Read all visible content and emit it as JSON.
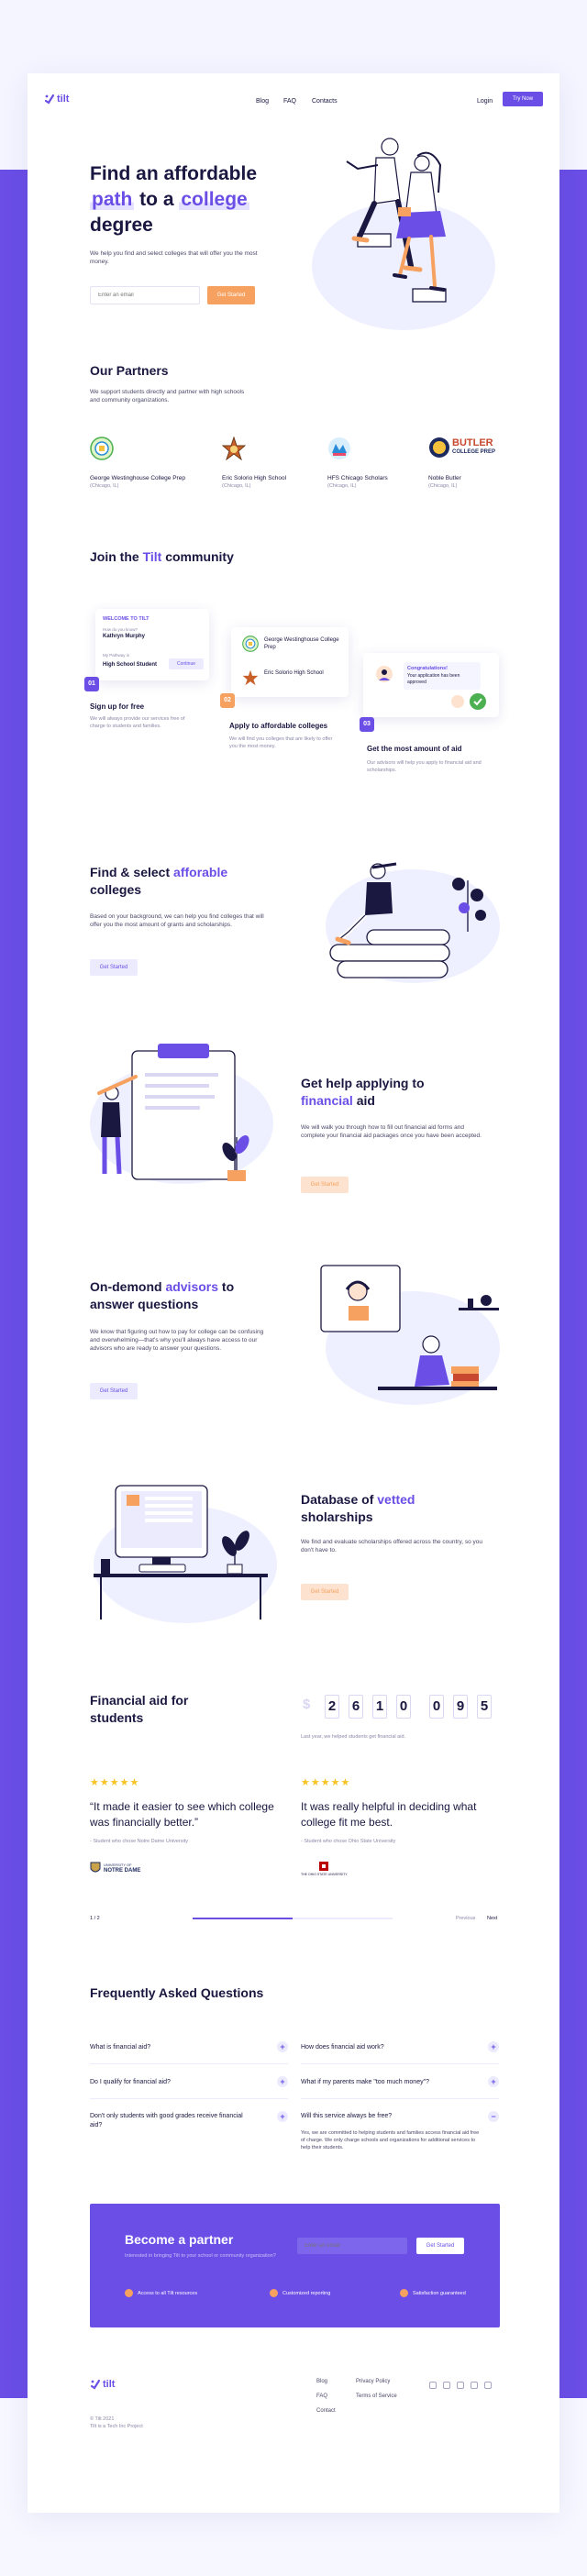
{
  "brand": {
    "logo": "tilt",
    "accent": "#6a4ee6",
    "orange": "#f6a15f"
  },
  "nav": {
    "links": [
      "Blog",
      "FAQ",
      "Contacts"
    ],
    "login": "Login",
    "cta": "Try Now"
  },
  "hero": {
    "title_1": "Find an affordable",
    "title_hl_1": "path",
    "title_2": "to a",
    "title_hl_2": "college",
    "title_3": "degree",
    "subtitle": "We help you find and select colleges that will offer you the most money.",
    "input_placeholder": "Enter an email",
    "button": "Get Started"
  },
  "partners": {
    "title": "Our Partners",
    "subtitle": "We support students directly and partner with high schools and community organizations.",
    "items": [
      {
        "name": "George Westinghouse College Prep",
        "location": "(Chicago, IL)"
      },
      {
        "name": "Eric Solorio High School",
        "location": "(Chicago, IL)"
      },
      {
        "name": "HFS Chicago Scholars",
        "location": "(Chicago, IL)"
      },
      {
        "name": "Noble Butler",
        "location": "(Chicago, IL)"
      }
    ],
    "butler_logo_1": "BUTLER",
    "butler_logo_2": "COLLEGE PREP"
  },
  "community": {
    "title_1": "Join the",
    "title_hl": "Tilt",
    "title_2": "community",
    "signup_card": {
      "heading": "WELCOME TO TILT",
      "field_1_label": "How do you know?",
      "field_1_value": "Kathryn Murphy",
      "field_2_label": "My Pathway is",
      "field_2_value": "High School Student",
      "button": "Continue"
    },
    "steps": [
      {
        "num": "01",
        "title": "Sign up for free",
        "text": "We will always provide our services free of charge to students and families."
      },
      {
        "num": "02",
        "title": "Apply to affordable colleges",
        "text": "We will find you colleges that are likely to offer you the most money."
      },
      {
        "num": "03",
        "title": "Get the most amount of aid",
        "text": "Our advisors will help you apply to financial aid and scholarships."
      }
    ],
    "apply_card": [
      "George Westinghouse College Prep",
      "Eric Solorio High School"
    ],
    "aid_card": {
      "line_1": "Congratulations!",
      "line_2": "Your application has been approved"
    }
  },
  "features": [
    {
      "title_1": "Find & select",
      "title_hl": "afforable",
      "title_2": "colleges",
      "text": "Based on your background, we can help you find colleges that will offer you the most amount of grants and scholarships.",
      "button": "Get Started"
    },
    {
      "title_1": "Get help applying to",
      "title_hl": "financial",
      "title_2": "aid",
      "text": "We will walk you through how to fill out financial aid forms and complete your financial aid packages once you have been accepted.",
      "button": "Get Started"
    },
    {
      "title_1": "On-demond",
      "title_hl": "advisors",
      "title_2": "to answer questions",
      "text": "We know that figuring out how to pay for college can be confusing and overwhelming—that's why you'll always have access to our advisors who are ready to answer your questions.",
      "button": "Get Started"
    },
    {
      "title_1": "Database of",
      "title_hl": "vetted",
      "title_2": "sholarships",
      "text": "We find and evaluate scholarships offered across the country, so you don't have to.",
      "button": "Get Started"
    }
  ],
  "stats": {
    "title": "Financial aid for students",
    "dollar": "$",
    "digits": [
      "2",
      "6",
      "1",
      "0",
      "0",
      "9",
      "5"
    ],
    "caption": "Last year, we helped students get financial aid."
  },
  "testimonials": {
    "stars": "★★★★★",
    "items": [
      {
        "quote": "“It made it easier to see which college was financially better.”",
        "author": "- Student who chose Notre Dame University",
        "logo_1": "UNIVERSITY OF",
        "logo_2": "NOTRE DAME"
      },
      {
        "quote": "It was really helpful in deciding what college fit me best.",
        "author": "- Student who chose Ohio State University",
        "logo_1": "THE OHIO STATE UNIVERSITY"
      }
    ],
    "pager": "1 / 2",
    "progress": 0.5,
    "prev": "Previous",
    "next": "Next"
  },
  "faq": {
    "title": "Frequently Asked Questions",
    "items": [
      {
        "q": "What is financial aid?",
        "toggle": "+"
      },
      {
        "q": "How does financial aid work?",
        "toggle": "+"
      },
      {
        "q": "Do I qualify for financial aid?",
        "toggle": "+"
      },
      {
        "q": "What if my parents make \"too much money\"?",
        "toggle": "+"
      },
      {
        "q": "Don't only students with good grades receive financial aid?",
        "toggle": "+"
      },
      {
        "q": "Will this service always be free?",
        "toggle": "−",
        "answer": "Yes, we are committed to helping students and families access financial aid free of charge. We only charge schools and organizations for additional services to help their students."
      }
    ]
  },
  "partner_cta": {
    "title": "Become a partner",
    "subtitle": "Interested in bringing Tilt to your school or community organization?",
    "input_placeholder": "Enter an email",
    "button": "Get Started",
    "features": [
      "Access to all Tilt resources",
      "Customized reporting",
      "Satisfaction guaranteed"
    ]
  },
  "footer": {
    "logo": "tilt",
    "col_1": [
      "Blog",
      "FAQ",
      "Contact"
    ],
    "col_2": [
      "Privacy Policy",
      "Terms of Service"
    ],
    "copyright_1": "© Tilt 2021",
    "copyright_2": "Tilt is a Tech Inc Project"
  }
}
